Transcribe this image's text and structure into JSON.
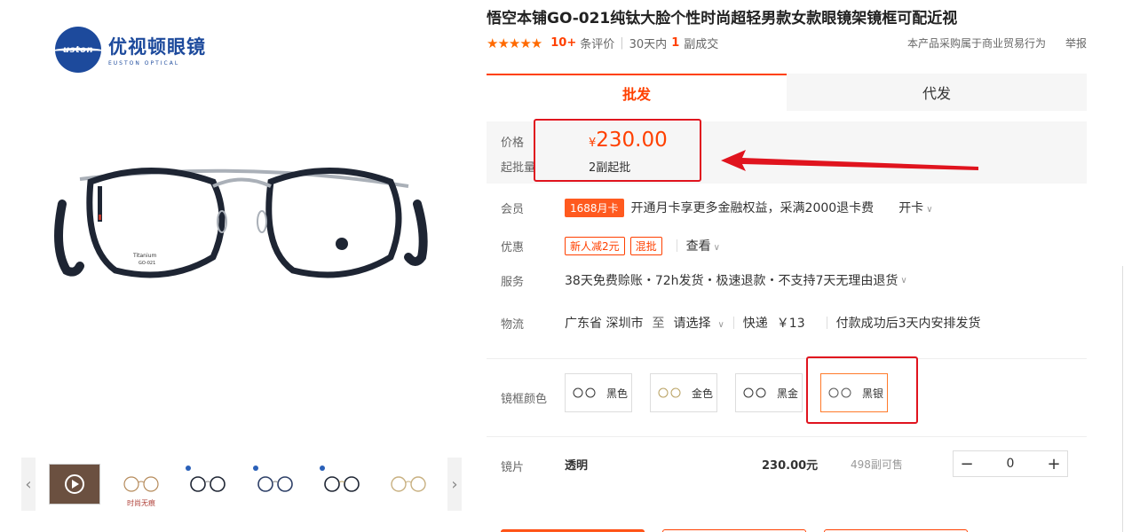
{
  "logo": {
    "cn": "优视顿眼镜",
    "en": "EUSTON OPTICAL",
    "mark": "uston"
  },
  "main_image": {
    "model": "GO-021",
    "material": "Titanium"
  },
  "thumbnails": [
    {
      "type": "video",
      "caption": ""
    },
    {
      "type": "image",
      "caption": "时尚无痕"
    },
    {
      "type": "image",
      "caption": ""
    },
    {
      "type": "image",
      "caption": ""
    },
    {
      "type": "image",
      "caption": ""
    },
    {
      "type": "image",
      "caption": ""
    }
  ],
  "product": {
    "title": "悟空本铺GO-021纯钛大脸个性时尚超轻男款女款眼镜架镜框可配近视",
    "stars": "★★★★★",
    "review_count": "10+",
    "review_label": "条评价",
    "sold_prefix": "30天内",
    "sold_count": "1",
    "sold_suffix": "副成交",
    "purchase_note": "本产品采购属于商业贸易行为",
    "report": "举报"
  },
  "tabs": [
    {
      "label": "批发",
      "active": true
    },
    {
      "label": "代发",
      "active": false
    }
  ],
  "price": {
    "label": "价格",
    "currency": "¥",
    "value": "230.00",
    "moq_label": "起批量",
    "moq_value": "2副起批"
  },
  "member": {
    "label": "会员",
    "badge": "1688月卡",
    "text": "开通月卡享更多金融权益，采满2000退卡费",
    "action": "开卡"
  },
  "discount": {
    "label": "优惠",
    "tags": [
      "新人减2元",
      "混批"
    ],
    "action": "查看"
  },
  "service": {
    "label": "服务",
    "text": "38天免费赊账・72h发货・极速退款・不支持7天无理由退货"
  },
  "logistics": {
    "label": "物流",
    "from": "广东省 深圳市",
    "to_label": "至",
    "select": "请选择",
    "express": "快递",
    "fee": "￥13",
    "note": "付款成功后3天内安排发货"
  },
  "frame_color": {
    "label": "镜框颜色",
    "options": [
      "黑色",
      "金色",
      "黑金",
      "黑银"
    ],
    "selected": "黑银"
  },
  "lens": {
    "label": "镜片",
    "name": "透明",
    "price": "230.00元",
    "stock": "498副可售",
    "minus": "−",
    "quantity": "0",
    "plus": "+"
  },
  "colors": {
    "accent": "#ff4000",
    "annotation": "#e0141e",
    "brand_blue": "#1d4a9c"
  }
}
